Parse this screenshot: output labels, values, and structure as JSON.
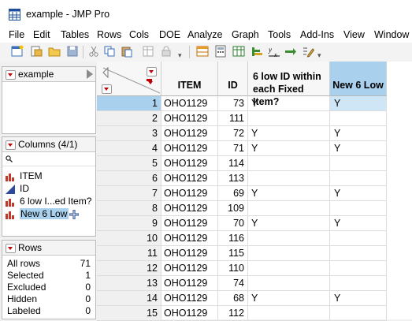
{
  "window": {
    "title": "example - JMP Pro"
  },
  "menu": [
    "File",
    "Edit",
    "Tables",
    "Rows",
    "Cols",
    "DOE",
    "Analyze",
    "Graph",
    "Tools",
    "Add-Ins",
    "View",
    "Window"
  ],
  "toolbar_icons": [
    "new-data-table-icon",
    "open-icon",
    "folder-icon",
    "save-icon",
    "cut-icon",
    "copy-icon",
    "paste-icon",
    "copy-table-icon",
    "lock-icon",
    "data-grid-icon",
    "calculator-icon",
    "table-icon",
    "distribution-icon",
    "fit-y-by-x-icon",
    "fit-model-icon",
    "pencil-icon",
    "dropdown-icon"
  ],
  "table_panel": {
    "title": "example"
  },
  "columns_panel": {
    "title": "Columns (4/1)",
    "search_placeholder": "",
    "items": [
      {
        "label": "ITEM",
        "type": "nominal"
      },
      {
        "label": "ID",
        "type": "continuous"
      },
      {
        "label": "6 low I...ed Item?",
        "type": "nominal"
      },
      {
        "label": "New 6 Low",
        "type": "nominal",
        "selected": true
      }
    ]
  },
  "rows_panel": {
    "title": "Rows",
    "stats": [
      {
        "label": "All rows",
        "value": "71"
      },
      {
        "label": "Selected",
        "value": "1"
      },
      {
        "label": "Excluded",
        "value": "0"
      },
      {
        "label": "Hidden",
        "value": "0"
      },
      {
        "label": "Labeled",
        "value": "0"
      }
    ]
  },
  "grid": {
    "headers": {
      "item": "ITEM",
      "id": "ID",
      "six_low_line1": "6 low ID within",
      "six_low_line2": "each Fixed Item?",
      "new6": "New 6 Low"
    },
    "rows": [
      {
        "n": "1",
        "item": "OHO1129",
        "id": "73",
        "six": "Y",
        "new6": "Y",
        "selected": true
      },
      {
        "n": "2",
        "item": "OHO1129",
        "id": "111",
        "six": "",
        "new6": ""
      },
      {
        "n": "3",
        "item": "OHO1129",
        "id": "72",
        "six": "Y",
        "new6": "Y"
      },
      {
        "n": "4",
        "item": "OHO1129",
        "id": "71",
        "six": "Y",
        "new6": "Y"
      },
      {
        "n": "5",
        "item": "OHO1129",
        "id": "114",
        "six": "",
        "new6": ""
      },
      {
        "n": "6",
        "item": "OHO1129",
        "id": "113",
        "six": "",
        "new6": ""
      },
      {
        "n": "7",
        "item": "OHO1129",
        "id": "69",
        "six": "Y",
        "new6": "Y"
      },
      {
        "n": "8",
        "item": "OHO1129",
        "id": "109",
        "six": "",
        "new6": ""
      },
      {
        "n": "9",
        "item": "OHO1129",
        "id": "70",
        "six": "Y",
        "new6": "Y"
      },
      {
        "n": "10",
        "item": "OHO1129",
        "id": "116",
        "six": "",
        "new6": ""
      },
      {
        "n": "11",
        "item": "OHO1129",
        "id": "115",
        "six": "",
        "new6": ""
      },
      {
        "n": "12",
        "item": "OHO1129",
        "id": "110",
        "six": "",
        "new6": ""
      },
      {
        "n": "13",
        "item": "OHO1129",
        "id": "74",
        "six": "",
        "new6": ""
      },
      {
        "n": "14",
        "item": "OHO1129",
        "id": "68",
        "six": "Y",
        "new6": "Y"
      },
      {
        "n": "15",
        "item": "OHO1129",
        "id": "112",
        "six": "",
        "new6": ""
      }
    ]
  },
  "colors": {
    "selection": "#a9d1ee",
    "red_triangle": "#c00000",
    "nominal_icon": "#c0392b",
    "continuous_icon": "#2e4a9a"
  }
}
